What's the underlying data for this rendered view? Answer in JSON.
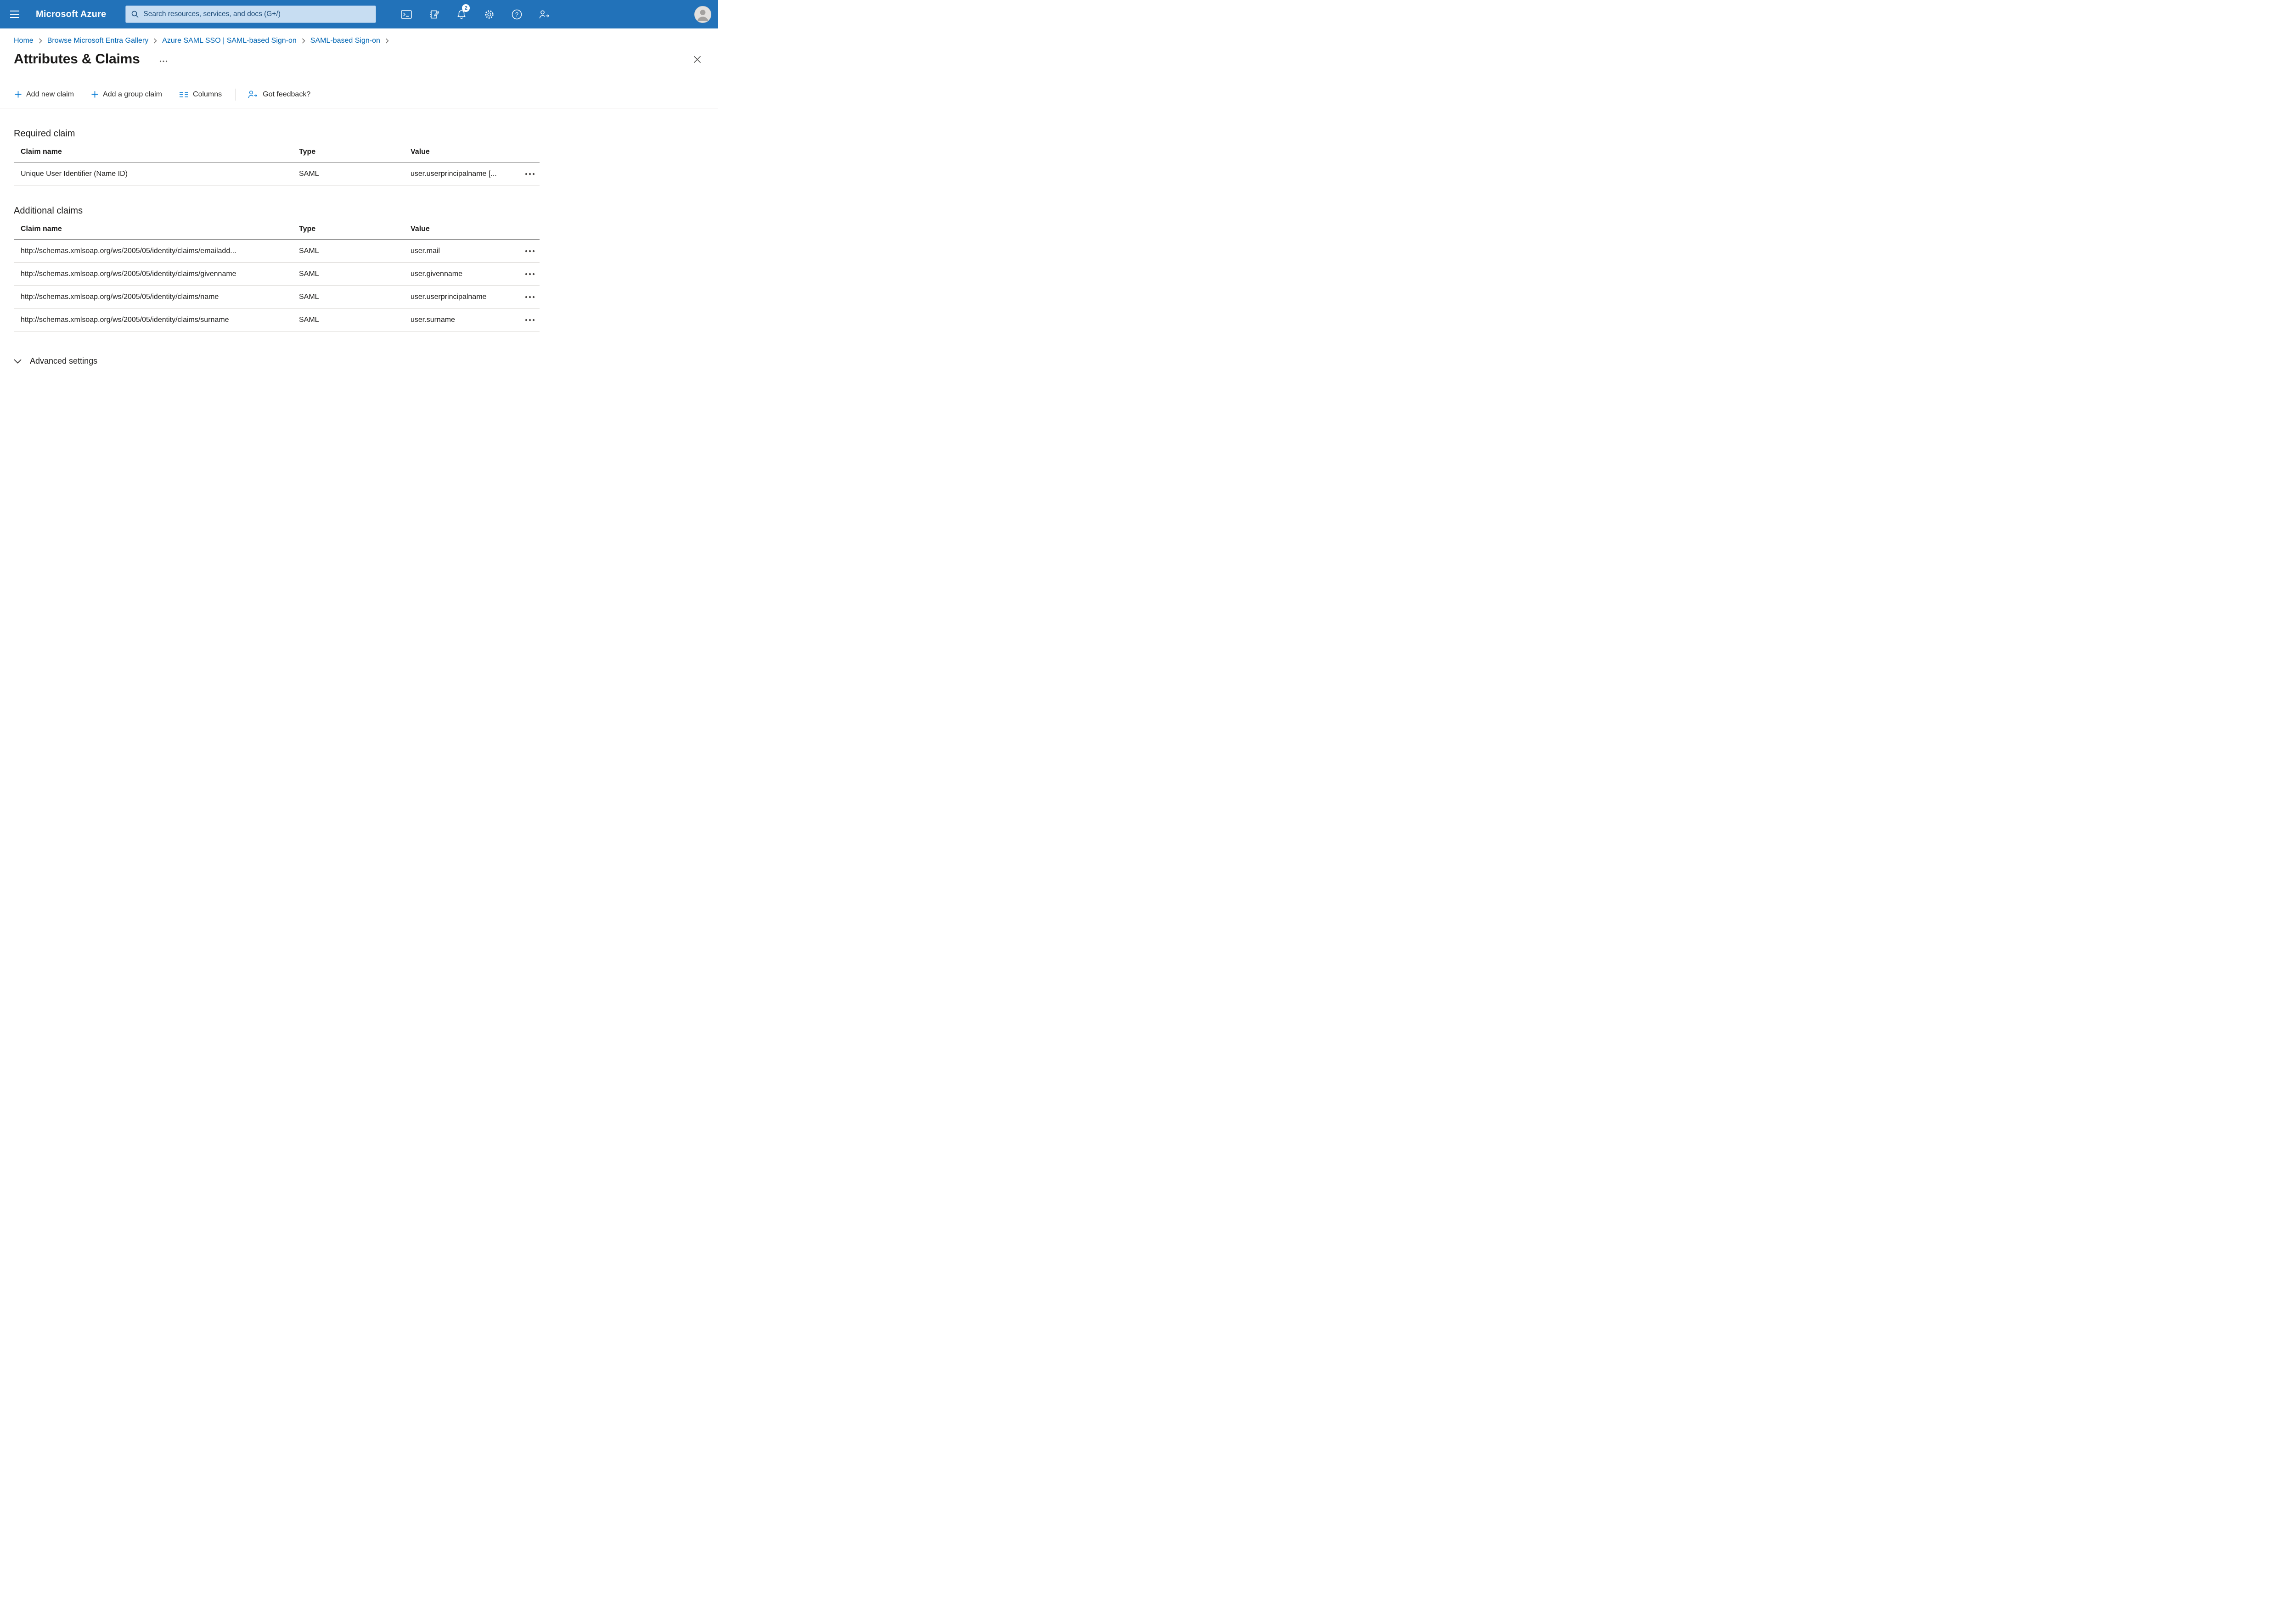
{
  "topbar": {
    "product": "Microsoft Azure",
    "search_placeholder": "Search resources, services, and docs (G+/)",
    "notification_badge": "2"
  },
  "breadcrumb": {
    "items": [
      "Home",
      "Browse Microsoft Entra Gallery",
      "Azure SAML SSO | SAML-based Sign-on",
      "SAML-based Sign-on"
    ]
  },
  "page": {
    "title": "Attributes & Claims"
  },
  "toolbar": {
    "add_new_claim": "Add new claim",
    "add_group_claim": "Add a group claim",
    "columns": "Columns",
    "got_feedback": "Got feedback?"
  },
  "required_claim": {
    "heading": "Required claim",
    "col_name": "Claim name",
    "col_type": "Type",
    "col_value": "Value",
    "rows": [
      {
        "name": "Unique User Identifier (Name ID)",
        "type": "SAML",
        "value": "user.userprincipalname [..."
      }
    ]
  },
  "additional_claims": {
    "heading": "Additional claims",
    "col_name": "Claim name",
    "col_type": "Type",
    "col_value": "Value",
    "rows": [
      {
        "name": "http://schemas.xmlsoap.org/ws/2005/05/identity/claims/emailadd...",
        "type": "SAML",
        "value": "user.mail"
      },
      {
        "name": "http://schemas.xmlsoap.org/ws/2005/05/identity/claims/givenname",
        "type": "SAML",
        "value": "user.givenname"
      },
      {
        "name": "http://schemas.xmlsoap.org/ws/2005/05/identity/claims/name",
        "type": "SAML",
        "value": "user.userprincipalname"
      },
      {
        "name": "http://schemas.xmlsoap.org/ws/2005/05/identity/claims/surname",
        "type": "SAML",
        "value": "user.surname"
      }
    ]
  },
  "advanced": {
    "label": "Advanced settings"
  }
}
